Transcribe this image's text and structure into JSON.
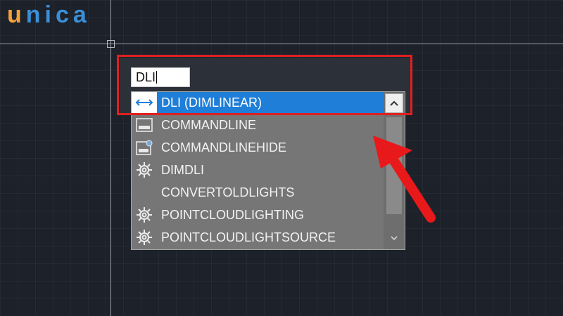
{
  "brand": {
    "logo_first": "u",
    "logo_rest": "nica",
    "accent_blue": "#3b8fd6",
    "accent_orange": "#f2a33a"
  },
  "command_line": {
    "input_value": "DLI"
  },
  "autocomplete": {
    "items": [
      {
        "label": "DLI (DIMLINEAR)",
        "icon": "dimlinear-icon",
        "selected": true
      },
      {
        "label": "COMMANDLINE",
        "icon": "commandline-icon",
        "selected": false
      },
      {
        "label": "COMMANDLINEHIDE",
        "icon": "commandlinehide-icon",
        "selected": false
      },
      {
        "label": "DIMDLI",
        "icon": "gear-icon",
        "selected": false
      },
      {
        "label": "CONVERTOLDLIGHTS",
        "icon": "",
        "selected": false
      },
      {
        "label": "POINTCLOUDLIGHTING",
        "icon": "gear-icon",
        "selected": false
      },
      {
        "label": "POINTCLOUDLIGHTSOURCE",
        "icon": "gear-icon",
        "selected": false
      }
    ],
    "scroll_up_icon": "chevron-up-icon",
    "scroll_down_icon": "chevron-down-icon",
    "selection_color": "#1f7ed8"
  },
  "annotation": {
    "highlight_color": "#e0201f",
    "arrow_color": "#e8191a"
  }
}
